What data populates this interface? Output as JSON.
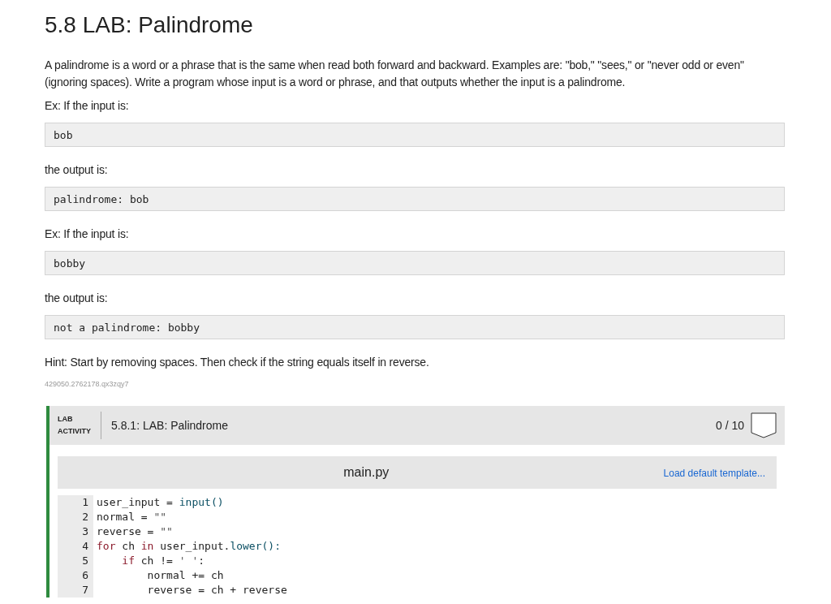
{
  "title": "5.8 LAB: Palindrome",
  "blocks": [
    {
      "kind": "text",
      "text": "A palindrome is a word or a phrase that is the same when read both forward and backward. Examples are: \"bob,\" \"sees,\" or \"never odd or even\" (ignoring spaces). Write a program whose input is a word or phrase, and that outputs whether the input is a palindrome."
    },
    {
      "kind": "text",
      "text": "Ex: If the input is:"
    },
    {
      "kind": "code",
      "text": "bob"
    },
    {
      "kind": "text",
      "text": "the output is:"
    },
    {
      "kind": "code",
      "text": "palindrome: bob"
    },
    {
      "kind": "text",
      "text": "Ex: If the input is:"
    },
    {
      "kind": "code",
      "text": "bobby"
    },
    {
      "kind": "text",
      "text": "the output is:"
    },
    {
      "kind": "code",
      "text": "not a palindrome: bobby"
    },
    {
      "kind": "text",
      "text": "Hint: Start by removing spaces. Then check if the string equals itself in reverse."
    },
    {
      "kind": "id",
      "text": "429050.2762178.qx3zqy7"
    }
  ],
  "lab": {
    "label_1": "LAB",
    "label_2": "ACTIVITY",
    "title": "5.8.1: LAB: Palindrome",
    "score": "0 / 10",
    "editor": {
      "filename": "main.py",
      "template_link": "Load default template...",
      "lines": [
        {
          "number": "1",
          "tokens": [
            {
              "kind": "plain",
              "text": "user_input = "
            },
            {
              "kind": "builtin",
              "text": "input()"
            }
          ]
        },
        {
          "number": "2",
          "tokens": [
            {
              "kind": "plain",
              "text": "normal = "
            },
            {
              "kind": "string",
              "text": "\"\""
            }
          ]
        },
        {
          "number": "3",
          "tokens": [
            {
              "kind": "plain",
              "text": "reverse = "
            },
            {
              "kind": "string",
              "text": "\"\""
            }
          ]
        },
        {
          "number": "4",
          "tokens": [
            {
              "kind": "keyword",
              "text": "for"
            },
            {
              "kind": "plain",
              "text": " ch "
            },
            {
              "kind": "keyword",
              "text": "in"
            },
            {
              "kind": "plain",
              "text": " user_input."
            },
            {
              "kind": "builtin",
              "text": "lower():"
            }
          ]
        },
        {
          "number": "5",
          "tokens": [
            {
              "kind": "keyword",
              "text": "    if"
            },
            {
              "kind": "plain",
              "text": " ch != "
            },
            {
              "kind": "string",
              "text": "' '"
            },
            {
              "kind": "plain",
              "text": ":"
            }
          ]
        },
        {
          "number": "6",
          "tokens": [
            {
              "kind": "plain",
              "text": "        normal += ch"
            }
          ]
        },
        {
          "number": "7",
          "tokens": [
            {
              "kind": "plain",
              "text": "        reverse = ch + reverse"
            }
          ]
        }
      ]
    }
  }
}
